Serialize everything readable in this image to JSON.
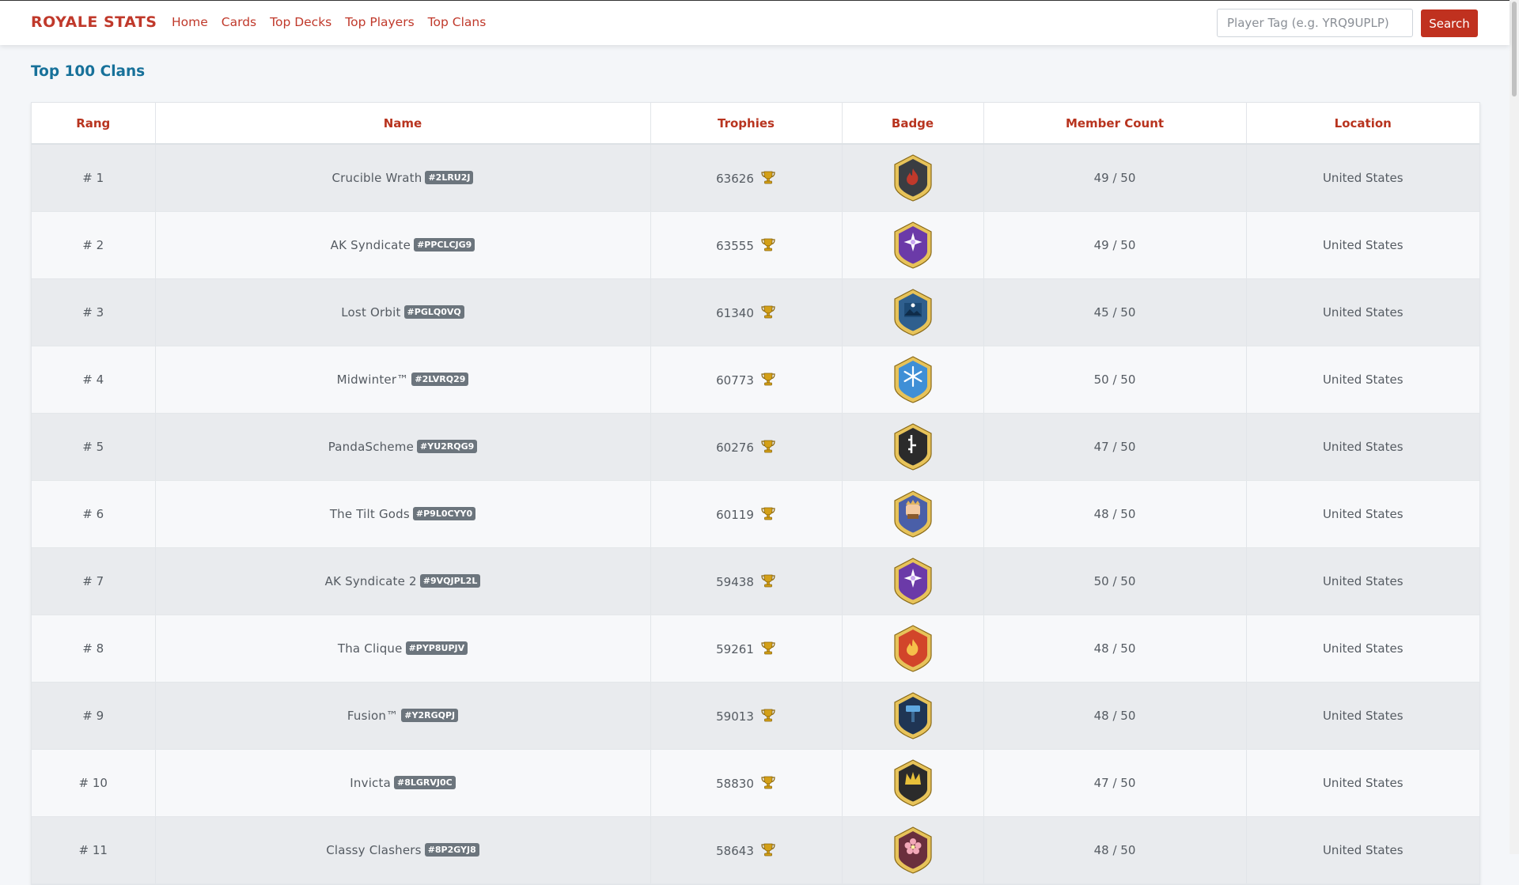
{
  "brand": "ROYALE STATS",
  "nav": [
    "Home",
    "Cards",
    "Top Decks",
    "Top Players",
    "Top Clans"
  ],
  "search": {
    "placeholder": "Player Tag (e.g. YRQ9UPLP)",
    "button": "Search"
  },
  "page_title": "Top 100 Clans",
  "table": {
    "headers": [
      "Rang",
      "Name",
      "Trophies",
      "Badge",
      "Member Count",
      "Location"
    ],
    "rows": [
      {
        "rank": "# 1",
        "name": "Crucible Wrath",
        "tag": "#2LRU2J",
        "trophies": "63626",
        "badge": "flame-badge-icon",
        "members": "49 / 50",
        "location": "United States"
      },
      {
        "rank": "# 2",
        "name": "AK Syndicate",
        "tag": "#PPCLCJG9",
        "trophies": "63555",
        "badge": "star-badge-icon",
        "members": "49 / 50",
        "location": "United States"
      },
      {
        "rank": "# 3",
        "name": "Lost Orbit",
        "tag": "#PGLQ0VQ",
        "trophies": "61340",
        "badge": "mountain-badge-icon",
        "members": "45 / 50",
        "location": "United States"
      },
      {
        "rank": "# 4",
        "name": "Midwinter™",
        "tag": "#2LVRQ29",
        "trophies": "60773",
        "badge": "snowflake-badge-icon",
        "members": "50 / 50",
        "location": "United States"
      },
      {
        "rank": "# 5",
        "name": "PandaScheme",
        "tag": "#YU2RQG9",
        "trophies": "60276",
        "badge": "bamboo-badge-icon",
        "members": "47 / 50",
        "location": "United States"
      },
      {
        "rank": "# 6",
        "name": "The Tilt Gods",
        "tag": "#P9L0CYY0",
        "trophies": "60119",
        "badge": "king-badge-icon",
        "members": "48 / 50",
        "location": "United States"
      },
      {
        "rank": "# 7",
        "name": "AK Syndicate 2",
        "tag": "#9VQJPL2L",
        "trophies": "59438",
        "badge": "star-badge-icon",
        "members": "50 / 50",
        "location": "United States"
      },
      {
        "rank": "# 8",
        "name": "Tha Clique",
        "tag": "#PYP8UPJV",
        "trophies": "59261",
        "badge": "fire-badge-icon",
        "members": "48 / 50",
        "location": "United States"
      },
      {
        "rank": "# 9",
        "name": "Fusion™",
        "tag": "#Y2RGQPJ",
        "trophies": "59013",
        "badge": "hammer-badge-icon",
        "members": "48 / 50",
        "location": "United States"
      },
      {
        "rank": "# 10",
        "name": "Invicta",
        "tag": "#8LGRVJ0C",
        "trophies": "58830",
        "badge": "crown-badge-icon",
        "members": "47 / 50",
        "location": "United States"
      },
      {
        "rank": "# 11",
        "name": "Classy Clashers",
        "tag": "#8P2GYJ8",
        "trophies": "58643",
        "badge": "flower-badge-icon",
        "members": "48 / 50",
        "location": "United States"
      }
    ]
  },
  "colors": {
    "accent": "#c0392b",
    "title": "#17719a"
  }
}
